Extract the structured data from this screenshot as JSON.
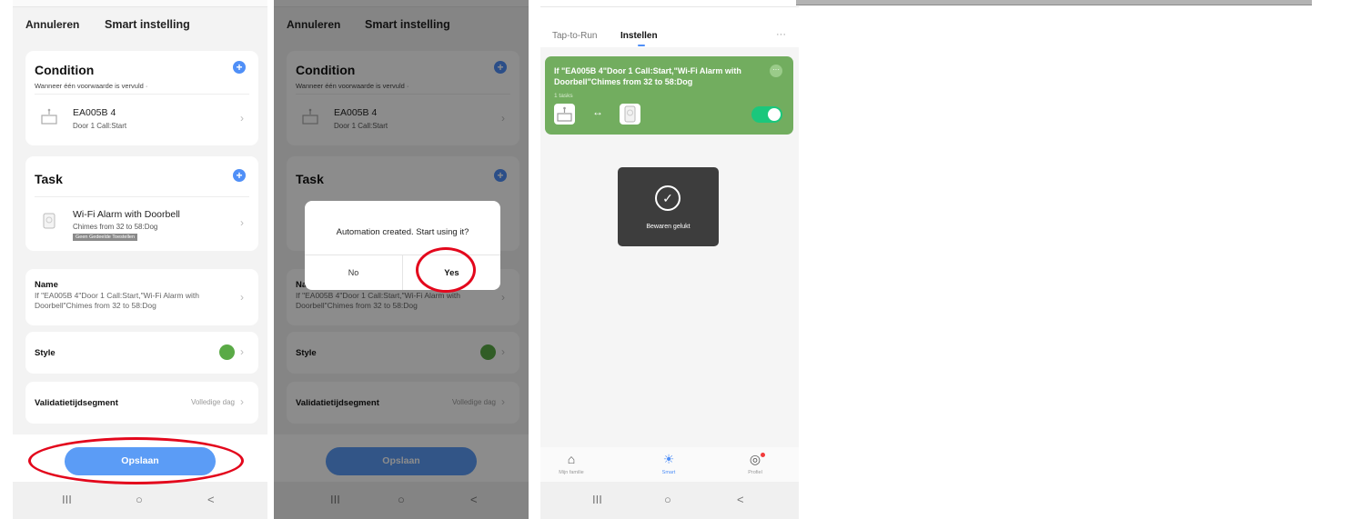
{
  "screen1": {
    "cancel": "Annuleren",
    "title": "Smart instelling",
    "condition": {
      "title": "Condition",
      "note": "Wanneer één voorwaarde is vervuld ·",
      "device": "EA005B 4",
      "detail": "Door 1 Call:Start"
    },
    "task": {
      "title": "Task",
      "device": "Wi-Fi Alarm with Doorbell",
      "detail": "Chimes from 32 to 58:Dog",
      "tag": "Geen Gedeelde Toestellen"
    },
    "name": {
      "label": "Name",
      "value": "If \"EA005B 4\"Door 1 Call:Start,\"Wi-Fi Alarm with Doorbell\"Chimes from 32 to 58:Dog"
    },
    "style_label": "Style",
    "style_color": "#5aaa46",
    "validity": {
      "label": "Validatietijdsegment",
      "value": "Volledige dag"
    },
    "save": "Opslaan"
  },
  "screen2": {
    "cancel": "Annuleren",
    "title": "Smart instelling",
    "condition": {
      "title": "Condition",
      "note": "Wanneer één voorwaarde is vervuld ·",
      "device": "EA005B 4",
      "detail": "Door 1 Call:Start"
    },
    "task_title": "Task",
    "name": {
      "label": "Na",
      "value": "If \"EA005B 4\"Door 1 Call:Start,\"Wi-Fi Alarm with Doorbell\"Chimes from 32 to 58:Dog"
    },
    "style_label": "Style",
    "validity": {
      "label": "Validatietijdsegment",
      "value": "Volledige dag"
    },
    "save": "Opslaan",
    "dialog": {
      "message": "Automation created. Start using it?",
      "no": "No",
      "yes": "Yes"
    }
  },
  "screen3": {
    "tabs": [
      "Tap-to-Run",
      "Instellen"
    ],
    "more": "···",
    "automation": {
      "title": "If \"EA005B 4\"Door 1 Call:Start,\"Wi-Fi Alarm with Doorbell\"Chimes from 32 to 58:Dog",
      "count": "1 tasks",
      "arrow": "↔",
      "enabled": true
    },
    "toast": "Bewaren gelukt",
    "bottom_tabs": [
      {
        "label": "Mijn familie",
        "icon": "home-icon"
      },
      {
        "label": "Smart",
        "icon": "sun-icon"
      },
      {
        "label": "Profiel",
        "icon": "profile-icon"
      }
    ]
  },
  "system_nav": {
    "recent": "III",
    "home": "○",
    "back": "<"
  },
  "colors": {
    "accent": "#4f8ff7",
    "automation_green": "#72ad5f",
    "highlight_red": "#e3071c",
    "toggle_on": "#1bc77c"
  }
}
